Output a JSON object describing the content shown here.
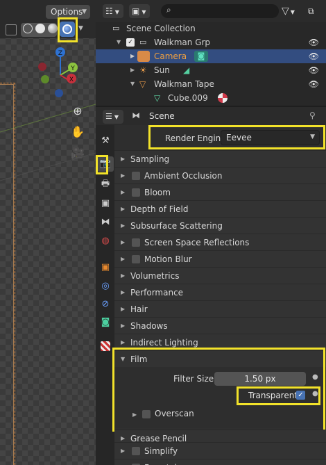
{
  "viewport": {
    "options_label": "Options",
    "gizmo": {
      "z": "Z",
      "y": "Y",
      "x": "X"
    }
  },
  "outliner": {
    "search_placeholder": "",
    "rows": [
      {
        "label": "Scene Collection"
      },
      {
        "label": "Walkman Grp"
      },
      {
        "label": "Camera"
      },
      {
        "label": "Sun"
      },
      {
        "label": "Walkman Tape"
      },
      {
        "label": "Cube.009"
      }
    ]
  },
  "properties": {
    "breadcrumb": "Scene",
    "render_engine_label": "Render Engine",
    "render_engine_value": "Eevee",
    "sections": [
      {
        "label": "Sampling"
      },
      {
        "label": "Ambient Occlusion"
      },
      {
        "label": "Bloom"
      },
      {
        "label": "Depth of Field"
      },
      {
        "label": "Subsurface Scattering"
      },
      {
        "label": "Screen Space Reflections"
      },
      {
        "label": "Motion Blur"
      },
      {
        "label": "Volumetrics"
      },
      {
        "label": "Performance"
      },
      {
        "label": "Hair"
      },
      {
        "label": "Shadows"
      },
      {
        "label": "Indirect Lighting"
      },
      {
        "label": "Film"
      },
      {
        "label": "Grease Pencil"
      },
      {
        "label": "Simplify"
      },
      {
        "label": "Freestyle"
      }
    ],
    "film": {
      "filter_size_label": "Filter Size",
      "filter_size_value": "1.50 px",
      "transparent_label": "Transparent",
      "transparent_checked": true,
      "overscan_label": "Overscan"
    }
  },
  "colors": {
    "highlight": "#f2e22a",
    "selection": "#334d80",
    "accent": "#4772b3"
  }
}
